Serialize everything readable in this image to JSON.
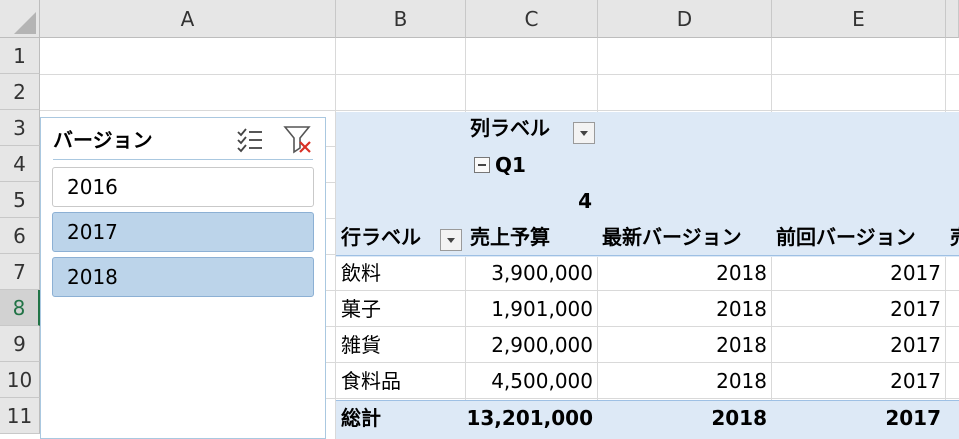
{
  "columns": [
    "A",
    "B",
    "C",
    "D",
    "E"
  ],
  "rows": [
    "1",
    "2",
    "3",
    "4",
    "5",
    "6",
    "7",
    "8",
    "9",
    "10",
    "11"
  ],
  "active_row": "8",
  "slicer": {
    "title": "バージョン",
    "icons": [
      "multi-select-icon",
      "clear-filter-icon"
    ],
    "items": [
      {
        "label": "2016",
        "selected": false
      },
      {
        "label": "2017",
        "selected": true
      },
      {
        "label": "2018",
        "selected": true
      }
    ]
  },
  "pivot": {
    "column_label": "列ラベル",
    "group": "Q1",
    "group_sub": "4",
    "row_label": "行ラベル",
    "headers": [
      "売上予算",
      "最新バージョン",
      "前回バージョン",
      "売"
    ],
    "rows": [
      {
        "label": "飲料",
        "budget": "3,900,000",
        "latest": "2018",
        "previous": "2017"
      },
      {
        "label": "菓子",
        "budget": "1,901,000",
        "latest": "2018",
        "previous": "2017"
      },
      {
        "label": "雑貨",
        "budget": "2,900,000",
        "latest": "2018",
        "previous": "2017"
      },
      {
        "label": "食料品",
        "budget": "4,500,000",
        "latest": "2018",
        "previous": "2017"
      }
    ],
    "total": {
      "label": "総計",
      "budget": "13,201,000",
      "latest": "2018",
      "previous": "2017"
    }
  },
  "colors": {
    "pivot_band": "#dde9f6",
    "slicer_selected": "#bcd4ea",
    "active_row_header": "#217346"
  }
}
